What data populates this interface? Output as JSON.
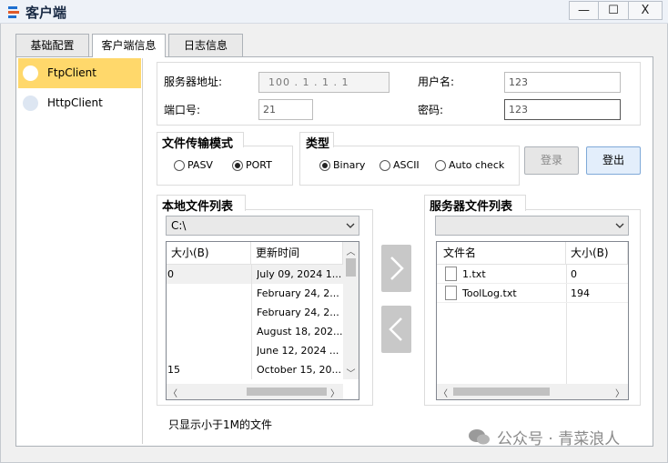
{
  "window": {
    "title": "客户端",
    "controls": {
      "minimize": "—",
      "maximize": "☐",
      "close": "X"
    }
  },
  "tabs": [
    {
      "label": "基础配置",
      "active": false
    },
    {
      "label": "客户端信息",
      "active": true
    },
    {
      "label": "日志信息",
      "active": false
    }
  ],
  "client_list": [
    {
      "label": "FtpClient",
      "selected": true
    },
    {
      "label": "HttpClient",
      "selected": false
    }
  ],
  "server": {
    "address_label": "服务器地址:",
    "address_value": "100 .  1  .  1  .  1",
    "port_label": "端口号:",
    "port_value": "21",
    "username_label": "用户名:",
    "username_value": "123",
    "password_label": "密码:",
    "password_value": "123"
  },
  "transfer_mode": {
    "label": "文件传输模式",
    "options": [
      {
        "label": "PASV",
        "selected": false
      },
      {
        "label": "PORT",
        "selected": true
      }
    ]
  },
  "type": {
    "label": "类型",
    "options": [
      {
        "label": "Binary",
        "selected": true
      },
      {
        "label": "ASCII",
        "selected": false
      },
      {
        "label": "Auto check",
        "selected": false
      }
    ]
  },
  "buttons": {
    "login": "登录",
    "logout": "登出"
  },
  "local_files": {
    "label": "本地文件列表",
    "path": "C:\\",
    "columns": [
      "大小(B)",
      "更新时间"
    ],
    "rows": [
      {
        "size": "0",
        "time": "July 09, 2024 1..."
      },
      {
        "size": "",
        "time": "February 24, 2..."
      },
      {
        "size": "",
        "time": "February 24, 2..."
      },
      {
        "size": "",
        "time": "August 18, 202..."
      },
      {
        "size": "",
        "time": "June 12, 2024 ..."
      },
      {
        "size": "15",
        "time": "October 15, 20..."
      }
    ]
  },
  "server_files": {
    "label": "服务器文件列表",
    "path": "",
    "columns": [
      "文件名",
      "大小(B)"
    ],
    "rows": [
      {
        "name": "1.txt",
        "size": "0"
      },
      {
        "name": "ToolLog.txt",
        "size": "194"
      }
    ]
  },
  "note": "只显示小于1M的文件",
  "watermark": "公众号 · 青菜浪人",
  "colors": {
    "selected_item": "#ffd86b",
    "accent": "#1e73c8"
  }
}
